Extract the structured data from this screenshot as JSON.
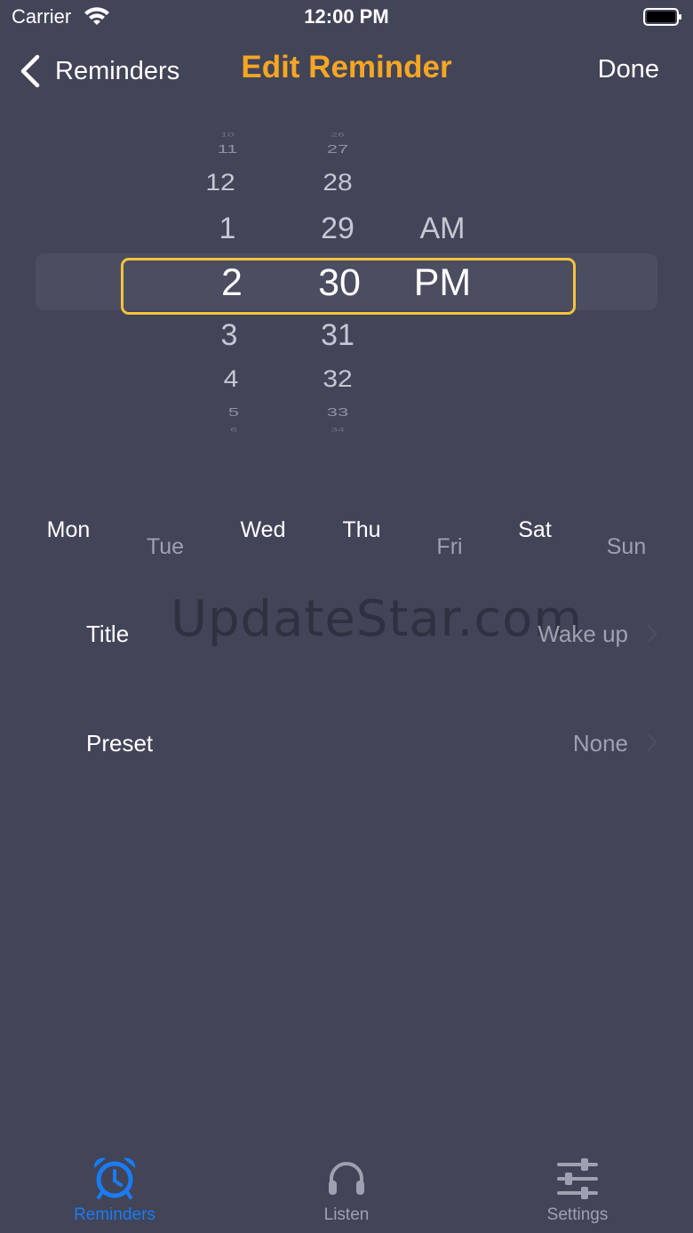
{
  "status_bar": {
    "carrier": "Carrier",
    "time": "12:00 PM"
  },
  "nav": {
    "back_label": "Reminders",
    "title": "Edit Reminder",
    "done_label": "Done"
  },
  "picker": {
    "hours": [
      {
        "text": "10"
      },
      {
        "text": "11"
      },
      {
        "text": "12"
      },
      {
        "text": "1"
      },
      {
        "text": "2"
      },
      {
        "text": "3"
      },
      {
        "text": "4"
      },
      {
        "text": "5"
      },
      {
        "text": "6"
      }
    ],
    "minutes": [
      {
        "text": "26"
      },
      {
        "text": "27"
      },
      {
        "text": "28"
      },
      {
        "text": "29"
      },
      {
        "text": "30"
      },
      {
        "text": "31"
      },
      {
        "text": "32"
      },
      {
        "text": "33"
      },
      {
        "text": "34"
      }
    ],
    "periods": [
      "AM",
      "PM"
    ],
    "selected_hour": "2",
    "selected_minute": "30",
    "selected_period": "PM"
  },
  "days": [
    {
      "label": "Mon",
      "active": true
    },
    {
      "label": "Tue",
      "active": false
    },
    {
      "label": "Wed",
      "active": true
    },
    {
      "label": "Thu",
      "active": true
    },
    {
      "label": "Fri",
      "active": false
    },
    {
      "label": "Sat",
      "active": true
    },
    {
      "label": "Sun",
      "active": false
    }
  ],
  "rows": {
    "title_label": "Title",
    "title_value": "Wake up",
    "preset_label": "Preset",
    "preset_value": "None"
  },
  "watermark": "UpdateStar.com",
  "tabs": [
    {
      "label": "Reminders",
      "icon": "alarm-clock-icon",
      "active": true
    },
    {
      "label": "Listen",
      "icon": "headphones-icon",
      "active": false
    },
    {
      "label": "Settings",
      "icon": "sliders-icon",
      "active": false
    }
  ],
  "colors": {
    "background": "#424458",
    "accent_title": "#f5a623",
    "picker_highlight": "#f7c23c",
    "tab_active": "#1a7cf5",
    "tab_inactive": "#9fa1b0"
  }
}
